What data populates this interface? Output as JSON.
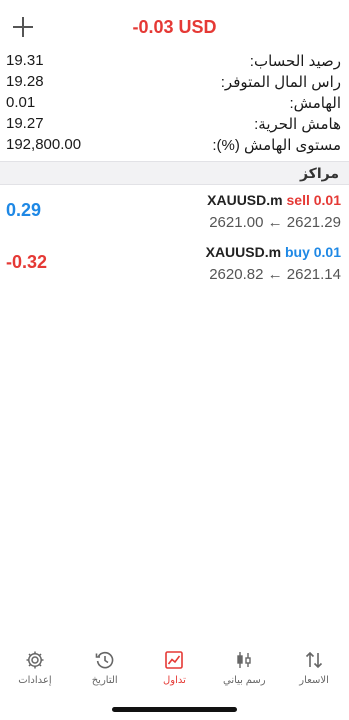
{
  "header": {
    "profit_total": "-0.03 USD"
  },
  "summary": [
    {
      "label": "رصيد الحساب:",
      "value": "19.31"
    },
    {
      "label": "راس المال المتوفر:",
      "value": "19.28"
    },
    {
      "label": "الهامش:",
      "value": "0.01"
    },
    {
      "label": "هامش الحرية:",
      "value": "19.27"
    },
    {
      "label": "مستوى الهامش (%):",
      "value": "192,800.00"
    }
  ],
  "positions_title": "مراكز",
  "positions": [
    {
      "symbol": "XAUUSD.m",
      "side": "sell 0.01",
      "prices": "2621.00 ← 2621.29",
      "profit": "0.29",
      "profit_color": "#1e88e5",
      "side_color": "#e53935"
    },
    {
      "symbol": "XAUUSD.m",
      "side": "buy 0.01",
      "prices": "2620.82 ← 2621.14",
      "profit": "-0.32",
      "profit_color": "#e53935",
      "side_color": "#1e88e5"
    }
  ],
  "tabs": [
    {
      "label": "إعدادات",
      "icon": "gear-icon"
    },
    {
      "label": "التاريخ",
      "icon": "history-icon"
    },
    {
      "label": "تداول",
      "icon": "trade-chart-icon",
      "active": true
    },
    {
      "label": "رسم بياني",
      "icon": "candlestick-icon"
    },
    {
      "label": "الاسعار",
      "icon": "quotes-arrows-icon"
    }
  ],
  "colors": {
    "accent": "#e53935",
    "blue": "#1e88e5"
  }
}
